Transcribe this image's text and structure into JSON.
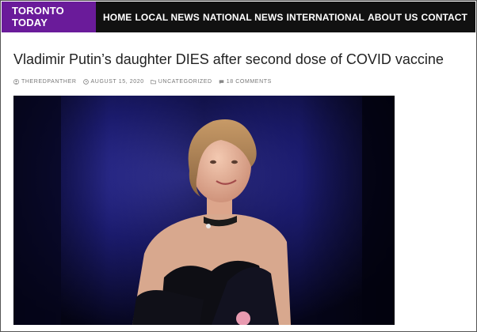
{
  "header": {
    "logo_line1": "TORONTO",
    "logo_line2": "TODAY",
    "nav": [
      "HOME",
      "LOCAL NEWS",
      "NATIONAL NEWS",
      "INTERNATIONAL",
      "ABOUT US",
      "CONTACT"
    ],
    "logo_bg": "#6a1b9a",
    "bar_bg": "#111111"
  },
  "article": {
    "title": "Vladimir Putin’s daughter DIES after second dose of COVID vaccine",
    "author": "THEREDPANTHER",
    "date": "AUGUST 15, 2020",
    "category": "UNCATEGORIZED",
    "comments": "18 COMMENTS",
    "icons": [
      "user-icon",
      "clock-icon",
      "folder-icon",
      "comment-icon"
    ]
  }
}
